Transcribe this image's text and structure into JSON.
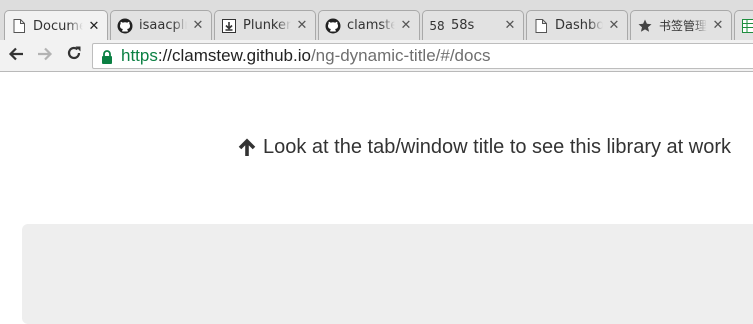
{
  "tabs": [
    {
      "title": "Document",
      "icon": "document-icon",
      "active": true
    },
    {
      "title": "isaacplmann",
      "icon": "github-icon",
      "active": false
    },
    {
      "title": "Plunker",
      "icon": "download-box-icon",
      "active": false
    },
    {
      "title": "clamstew",
      "icon": "github-icon",
      "active": false
    },
    {
      "title": "58s",
      "icon": "58-icon",
      "icon_text": "58",
      "active": false
    },
    {
      "title": "Dashboard",
      "icon": "document-icon",
      "active": false
    },
    {
      "title": "书签管理器",
      "icon": "star-icon",
      "active": false
    },
    {
      "title": "",
      "icon": "sheet-icon",
      "active": false
    }
  ],
  "tab_close_glyph": "✕",
  "toolbar": {
    "back_icon": "back-arrow-icon",
    "forward_icon": "forward-arrow-icon",
    "reload_icon": "reload-icon"
  },
  "omnibox": {
    "scheme": "https",
    "separator": "://",
    "host": "clamstew.github.io",
    "path": "/ng-dynamic-title/#/docs",
    "secure_color": "#0b8043"
  },
  "page": {
    "hint_text": "Look at the tab/window title to see this library at work",
    "hint_icon": "arrow-up-icon"
  }
}
